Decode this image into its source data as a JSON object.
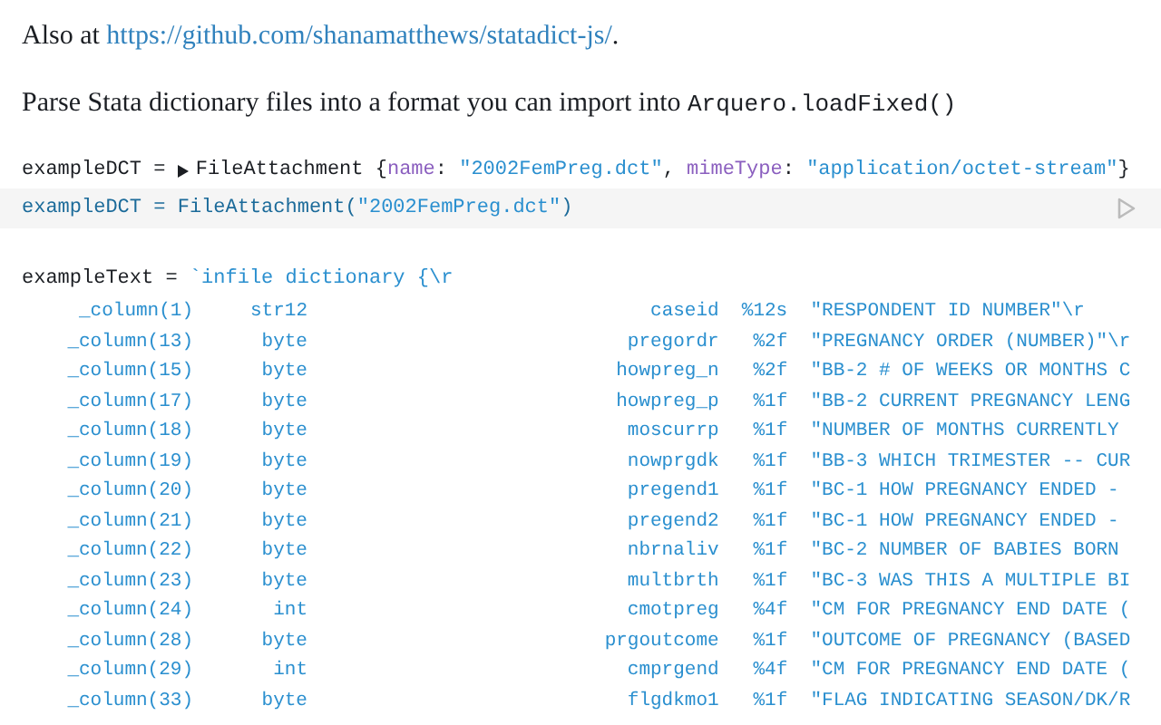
{
  "intro": {
    "prefix": "Also at ",
    "link": "https://github.com/shanamatthews/statadict-js/",
    "suffix": "."
  },
  "description": {
    "text": "Parse Stata dictionary files into a format you can import into ",
    "code": "Arquero.loadFixed()"
  },
  "output_cell": {
    "name": "exampleDCT",
    "operator": "=",
    "expanded": false,
    "class_name": "FileAttachment",
    "open_brace": "{",
    "fields": [
      {
        "key": "name",
        "colon": ":",
        "value": "\"2002FemPreg.dct\"",
        "separator": ","
      },
      {
        "key": "mimeType",
        "colon": ":",
        "value": "\"application/octet-stream\""
      }
    ],
    "close_brace": "}"
  },
  "input_cell": {
    "name": "exampleDCT",
    "operator": "=",
    "call": "FileAttachment",
    "open": "(",
    "argument": "\"2002FemPreg.dct\"",
    "close": ")"
  },
  "text_cell": {
    "name": "exampleText",
    "operator": "=",
    "opening": "`infile dictionary {\\r",
    "rows": [
      {
        "column": "_column(1)",
        "type": "str12",
        "variable": "caseid",
        "format": "%12s",
        "label": "\"RESPONDENT ID NUMBER\"\\r"
      },
      {
        "column": "_column(13)",
        "type": "byte",
        "variable": "pregordr",
        "format": "%2f",
        "label": "\"PREGNANCY ORDER (NUMBER)\"\\r"
      },
      {
        "column": "_column(15)",
        "type": "byte",
        "variable": "howpreg_n",
        "format": "%2f",
        "label": "\"BB-2 # OF WEEKS OR MONTHS C"
      },
      {
        "column": "_column(17)",
        "type": "byte",
        "variable": "howpreg_p",
        "format": "%1f",
        "label": "\"BB-2 CURRENT PREGNANCY LENG"
      },
      {
        "column": "_column(18)",
        "type": "byte",
        "variable": "moscurrp",
        "format": "%1f",
        "label": "\"NUMBER OF MONTHS CURRENTLY"
      },
      {
        "column": "_column(19)",
        "type": "byte",
        "variable": "nowprgdk",
        "format": "%1f",
        "label": "\"BB-3 WHICH TRIMESTER -- CUR"
      },
      {
        "column": "_column(20)",
        "type": "byte",
        "variable": "pregend1",
        "format": "%1f",
        "label": "\"BC-1 HOW PREGNANCY ENDED -"
      },
      {
        "column": "_column(21)",
        "type": "byte",
        "variable": "pregend2",
        "format": "%1f",
        "label": "\"BC-1 HOW PREGNANCY ENDED -"
      },
      {
        "column": "_column(22)",
        "type": "byte",
        "variable": "nbrnaliv",
        "format": "%1f",
        "label": "\"BC-2 NUMBER OF BABIES BORN"
      },
      {
        "column": "_column(23)",
        "type": "byte",
        "variable": "multbrth",
        "format": "%1f",
        "label": "\"BC-3 WAS THIS A MULTIPLE BI"
      },
      {
        "column": "_column(24)",
        "type": "int",
        "variable": "cmotpreg",
        "format": "%4f",
        "label": "\"CM FOR PREGNANCY END DATE ("
      },
      {
        "column": "_column(28)",
        "type": "byte",
        "variable": "prgoutcome",
        "format": "%1f",
        "label": "\"OUTCOME OF PREGNANCY (BASED"
      },
      {
        "column": "_column(29)",
        "type": "int",
        "variable": "cmprgend",
        "format": "%4f",
        "label": "\"CM FOR PREGNANCY END DATE ("
      },
      {
        "column": "_column(33)",
        "type": "byte",
        "variable": "flgdkmo1",
        "format": "%1f",
        "label": "\"FLAG INDICATING SEASON/DK/R"
      }
    ]
  }
}
